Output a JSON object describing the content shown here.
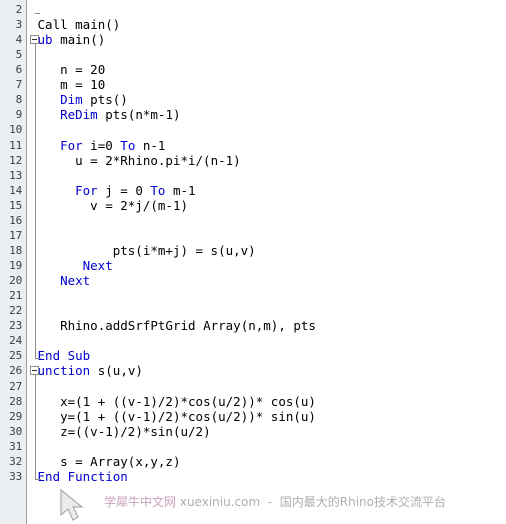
{
  "editor": {
    "name": "rhinoscript-vb-code-editor",
    "gutter_bg": "#eceff1",
    "code_bg": "#ffffff",
    "keyword_color": "#0000d0",
    "text_color": "#000000",
    "lineno_color": "#33404d",
    "first_line": 2,
    "last_line": 33
  },
  "line_numbers": [
    "2",
    "3",
    "4",
    "5",
    "6",
    "7",
    "8",
    "9",
    "10",
    "11",
    "12",
    "13",
    "14",
    "15",
    "16",
    "17",
    "18",
    "19",
    "20",
    "21",
    "22",
    "23",
    "24",
    "25",
    "26",
    "27",
    "28",
    "29",
    "30",
    "31",
    "32",
    "33"
  ],
  "lines": [
    {
      "n": "2",
      "indent": 0,
      "tokens": []
    },
    {
      "n": "3",
      "indent": 1,
      "tokens": [
        {
          "t": "Call main()",
          "k": false
        }
      ]
    },
    {
      "n": "4",
      "indent": 0,
      "tokens": [
        {
          "t": "Sub",
          "k": true
        },
        {
          "t": " main()",
          "k": false
        }
      ]
    },
    {
      "n": "5",
      "indent": 0,
      "tokens": []
    },
    {
      "n": "6",
      "indent": 4,
      "tokens": [
        {
          "t": "n = 20",
          "k": false
        }
      ]
    },
    {
      "n": "7",
      "indent": 4,
      "tokens": [
        {
          "t": "m = 10",
          "k": false
        }
      ]
    },
    {
      "n": "8",
      "indent": 4,
      "tokens": [
        {
          "t": "Dim",
          "k": true
        },
        {
          "t": " pts()",
          "k": false
        }
      ]
    },
    {
      "n": "9",
      "indent": 4,
      "tokens": [
        {
          "t": "ReDim",
          "k": true
        },
        {
          "t": " pts(n*m-1)",
          "k": false
        }
      ]
    },
    {
      "n": "10",
      "indent": 0,
      "tokens": []
    },
    {
      "n": "11",
      "indent": 4,
      "tokens": [
        {
          "t": "For",
          "k": true
        },
        {
          "t": " i=0 ",
          "k": false
        },
        {
          "t": "To",
          "k": true
        },
        {
          "t": " n-1",
          "k": false
        }
      ]
    },
    {
      "n": "12",
      "indent": 6,
      "tokens": [
        {
          "t": "u = 2*Rhino.pi*i/(n-1)",
          "k": false
        }
      ]
    },
    {
      "n": "13",
      "indent": 0,
      "tokens": []
    },
    {
      "n": "14",
      "indent": 6,
      "tokens": [
        {
          "t": "For",
          "k": true
        },
        {
          "t": " j = 0 ",
          "k": false
        },
        {
          "t": "To",
          "k": true
        },
        {
          "t": " m-1",
          "k": false
        }
      ]
    },
    {
      "n": "15",
      "indent": 8,
      "tokens": [
        {
          "t": "v = 2*j/(m-1)",
          "k": false
        }
      ]
    },
    {
      "n": "16",
      "indent": 0,
      "tokens": []
    },
    {
      "n": "17",
      "indent": 0,
      "tokens": []
    },
    {
      "n": "18",
      "indent": 11,
      "tokens": [
        {
          "t": "pts(i*m+j) = s(u,v)",
          "k": false
        }
      ]
    },
    {
      "n": "19",
      "indent": 7,
      "tokens": [
        {
          "t": "Next",
          "k": true
        }
      ]
    },
    {
      "n": "20",
      "indent": 4,
      "tokens": [
        {
          "t": "Next",
          "k": true
        }
      ]
    },
    {
      "n": "21",
      "indent": 0,
      "tokens": []
    },
    {
      "n": "22",
      "indent": 0,
      "tokens": []
    },
    {
      "n": "23",
      "indent": 4,
      "tokens": [
        {
          "t": "Rhino.addSrfPtGrid Array(n,m), pts",
          "k": false
        }
      ]
    },
    {
      "n": "24",
      "indent": 0,
      "tokens": []
    },
    {
      "n": "25",
      "indent": 1,
      "tokens": [
        {
          "t": "End Sub",
          "k": true
        }
      ]
    },
    {
      "n": "26",
      "indent": 0,
      "tokens": [
        {
          "t": "Function",
          "k": true
        },
        {
          "t": " s(u,v)",
          "k": false
        }
      ]
    },
    {
      "n": "27",
      "indent": 0,
      "tokens": []
    },
    {
      "n": "28",
      "indent": 4,
      "tokens": [
        {
          "t": "x=(1 + ((v-1)/2)*cos(u/2))* cos(u)",
          "k": false
        }
      ]
    },
    {
      "n": "29",
      "indent": 4,
      "tokens": [
        {
          "t": "y=(1 + ((v-1)/2)*cos(u/2))* sin(u)",
          "k": false
        }
      ]
    },
    {
      "n": "30",
      "indent": 4,
      "tokens": [
        {
          "t": "z=((v-1)/2)*sin(u/2)",
          "k": false
        }
      ]
    },
    {
      "n": "31",
      "indent": 0,
      "tokens": []
    },
    {
      "n": "32",
      "indent": 4,
      "tokens": [
        {
          "t": "s = Array(x,y,z)",
          "k": false
        }
      ]
    },
    {
      "n": "33",
      "indent": 1,
      "tokens": [
        {
          "t": "End Function",
          "k": true
        }
      ]
    }
  ],
  "fold_markers": [
    {
      "line": "4",
      "state": "expanded",
      "glyph": "minus-box"
    },
    {
      "line": "26",
      "state": "expanded",
      "glyph": "minus-box"
    }
  ],
  "watermark": {
    "site_cn": "学犀牛中文网",
    "site_url": "xuexiniu.com",
    "separator": "-",
    "tagline": "国内最大的Rhino技术交流平台",
    "full": "学犀牛中文网 xuexiniu.com  -  国内最大的Rhino技术交流平台",
    "cursor_icon": "mouse-pointer-icon"
  }
}
